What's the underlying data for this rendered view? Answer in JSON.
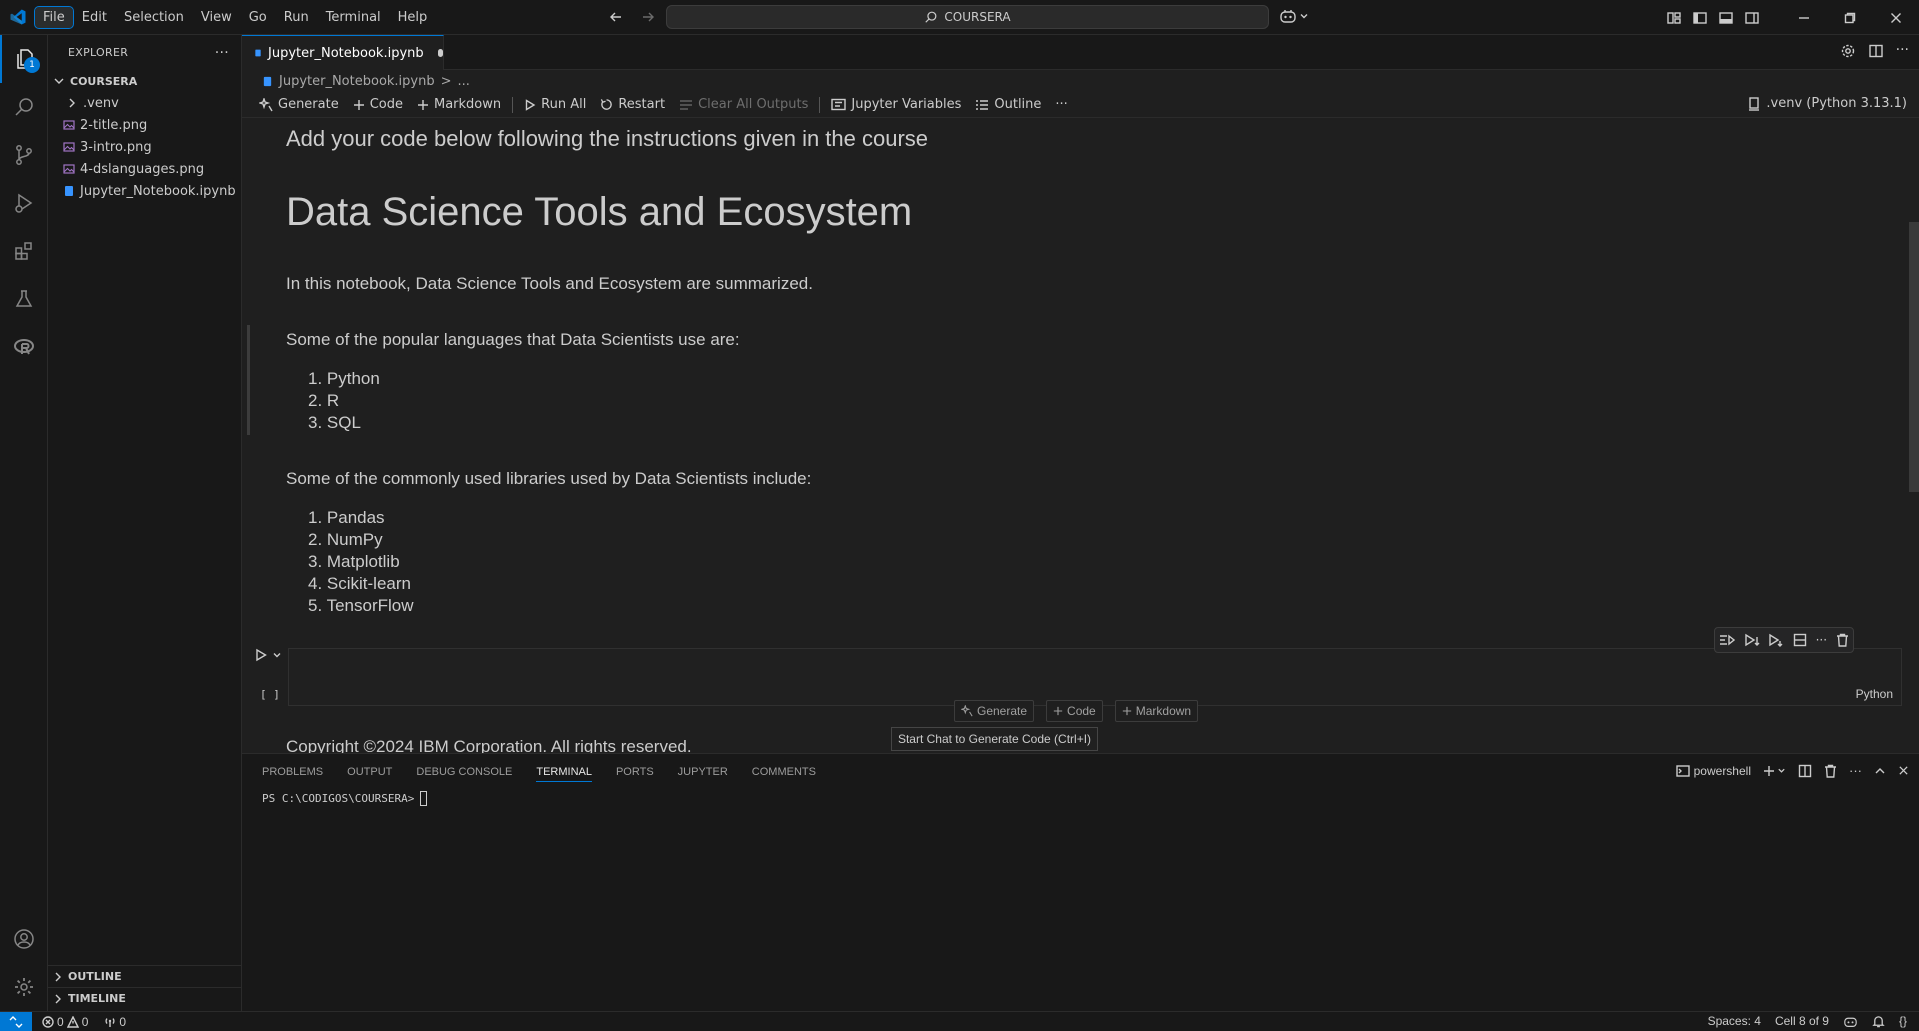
{
  "titlebar": {
    "menu": [
      "File",
      "Edit",
      "Selection",
      "View",
      "Go",
      "Run",
      "Terminal",
      "Help"
    ],
    "search_text": "COURSERA"
  },
  "activity": {
    "explorer_badge": "1"
  },
  "sidebar": {
    "title": "EXPLORER",
    "folder": "COURSERA",
    "items": [
      {
        "label": ".venv"
      },
      {
        "label": "2-title.png"
      },
      {
        "label": "3-intro.png"
      },
      {
        "label": "4-dslanguages.png"
      },
      {
        "label": "Jupyter_Notebook.ipynb"
      }
    ],
    "outline": "OUTLINE",
    "timeline": "TIMELINE"
  },
  "editor": {
    "tab_label": "Jupyter_Notebook.ipynb",
    "breadcrumb": [
      "Jupyter_Notebook.ipynb",
      ">",
      "..."
    ],
    "toolbar": {
      "generate": "Generate",
      "code": "Code",
      "markdown": "Markdown",
      "run_all": "Run All",
      "restart": "Restart",
      "clear_outputs": "Clear All Outputs",
      "variables": "Jupyter Variables",
      "outline": "Outline",
      "more": "···"
    },
    "kernel": ".venv (Python 3.13.1)"
  },
  "notebook": {
    "top_text": "Add your code below following the instructions given in the course",
    "title": "Data Science Tools and Ecosystem",
    "intro": "In this notebook, Data Science Tools and Ecosystem are summarized.",
    "languages_heading": "Some of the popular languages that Data Scientists use are:",
    "languages": [
      "1. Python",
      "2. R",
      "3. SQL"
    ],
    "libraries_heading": "Some of the commonly used libraries used by Data Scientists include:",
    "libraries": [
      "1. Pandas",
      "2. NumPy",
      "3. Matplotlib",
      "4. Scikit-learn",
      "5. TensorFlow"
    ],
    "code_cell_language": "Python",
    "exec_count": "[ ]",
    "insert_generate": "Generate",
    "insert_code": "Code",
    "insert_markdown": "Markdown",
    "tooltip": "Start Chat to Generate Code (Ctrl+I)",
    "copyright": "Copyright ©2024 IBM Corporation. All rights reserved."
  },
  "panel": {
    "tabs": [
      "PROBLEMS",
      "OUTPUT",
      "DEBUG CONSOLE",
      "TERMINAL",
      "PORTS",
      "JUPYTER",
      "COMMENTS"
    ],
    "active_tab": "TERMINAL",
    "shell": "powershell",
    "prompt": "PS C:\\CODIGOS\\COURSERA>"
  },
  "statusbar": {
    "errors": "0",
    "warnings": "0",
    "ports": "0",
    "spaces": "Spaces: 4",
    "cell": "Cell 8 of 9"
  },
  "colors": {
    "accent": "#0078d4",
    "background": "#1f1f1f",
    "chrome": "#181818"
  }
}
